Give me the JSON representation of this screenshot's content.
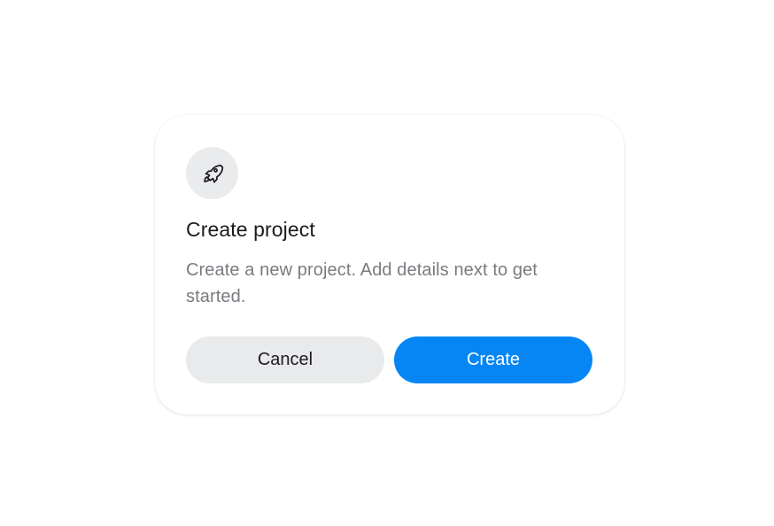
{
  "dialog": {
    "icon": "rocket-icon",
    "title": "Create project",
    "description": "Create a new project. Add details next to get started.",
    "cancel_label": "Cancel",
    "create_label": "Create"
  },
  "colors": {
    "primary": "#0686f5",
    "secondary_button": "#e9eaec",
    "icon_background": "#eaebed",
    "title_text": "#1c1c1e",
    "description_text": "#7a7b80",
    "background": "#ffffff"
  }
}
